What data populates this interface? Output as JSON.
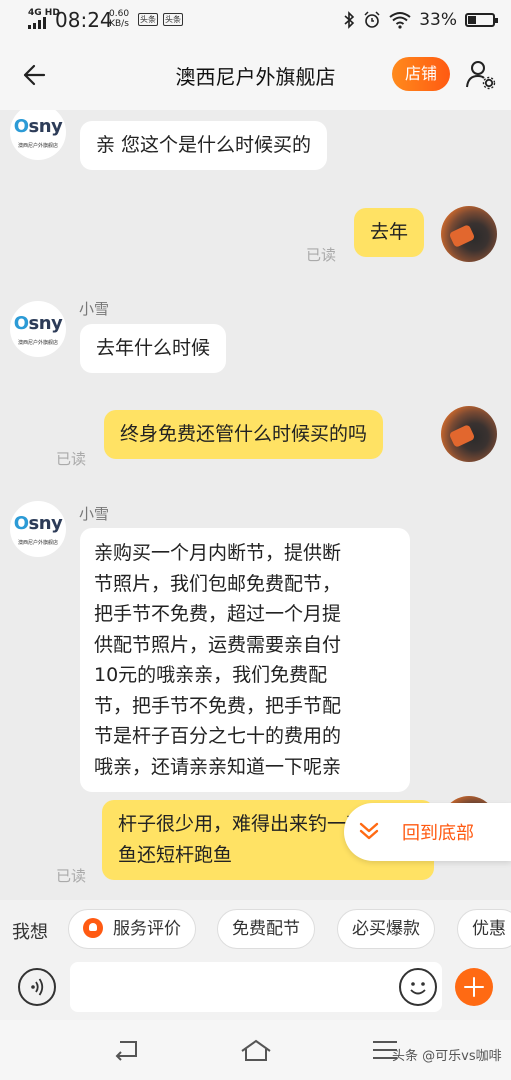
{
  "status_bar": {
    "network": "4G HD",
    "time": "08:24",
    "speed_value": "0.60",
    "speed_unit": "KB/s",
    "app_badge_1": "头条",
    "app_badge_2": "头条",
    "battery_percent": "33%",
    "battery_level": 0.33
  },
  "header": {
    "title": "澳西尼户外旗舰店",
    "shop_button": "店铺",
    "icons": {
      "back": "back-arrow-icon",
      "user": "user-settings-icon"
    }
  },
  "chat": {
    "shop_avatar_logo_pre": "O",
    "shop_avatar_logo_post": "sny",
    "shop_avatar_sub": "澳西尼户外旗舰店",
    "messages": [
      {
        "side": "in",
        "sender": "",
        "text": "亲 您这个是什么时候买的"
      },
      {
        "side": "out",
        "status": "已读",
        "text": "去年"
      },
      {
        "side": "in",
        "sender": "小雪",
        "text": "去年什么时候"
      },
      {
        "side": "out",
        "status": "已读",
        "text": "终身免费还管什么时候买的吗"
      },
      {
        "side": "in",
        "sender": "小雪",
        "lines": [
          "亲购买一个月内断节，提供断",
          "节照片，我们包邮免费配节，",
          "把手节不免费，超过一个月提",
          "供配节照片，运费需要亲自付",
          "10元的哦亲亲，我们免费配",
          "节，把手节不免费，把手节配",
          "节是杆子百分之七十的费用的",
          "哦亲，还请亲亲知道一下呢亲"
        ]
      },
      {
        "side": "out",
        "status": "已读",
        "lines": [
          "杆子很少用，难得出来钓一次",
          "鱼还短杆跑鱼"
        ]
      }
    ],
    "scroll_to_bottom": "回到底部"
  },
  "quick_bar": {
    "label": "我想",
    "chips": [
      "服务评价",
      "免费配节",
      "必买爆款",
      "优惠"
    ]
  },
  "input_bar": {
    "placeholder": "",
    "icons": {
      "voice": "voice-icon",
      "emoji": "emoji-icon",
      "more": "plus-icon"
    }
  },
  "nav_bar": {
    "icons": [
      "back-nav-icon",
      "home-nav-icon",
      "menu-nav-icon"
    ],
    "watermark": "头条 @可乐vs咖啡"
  },
  "colors": {
    "accent": "#ff5a12",
    "out_bubble": "#ffe264",
    "in_bubble": "#ffffff",
    "background": "#ececec"
  }
}
